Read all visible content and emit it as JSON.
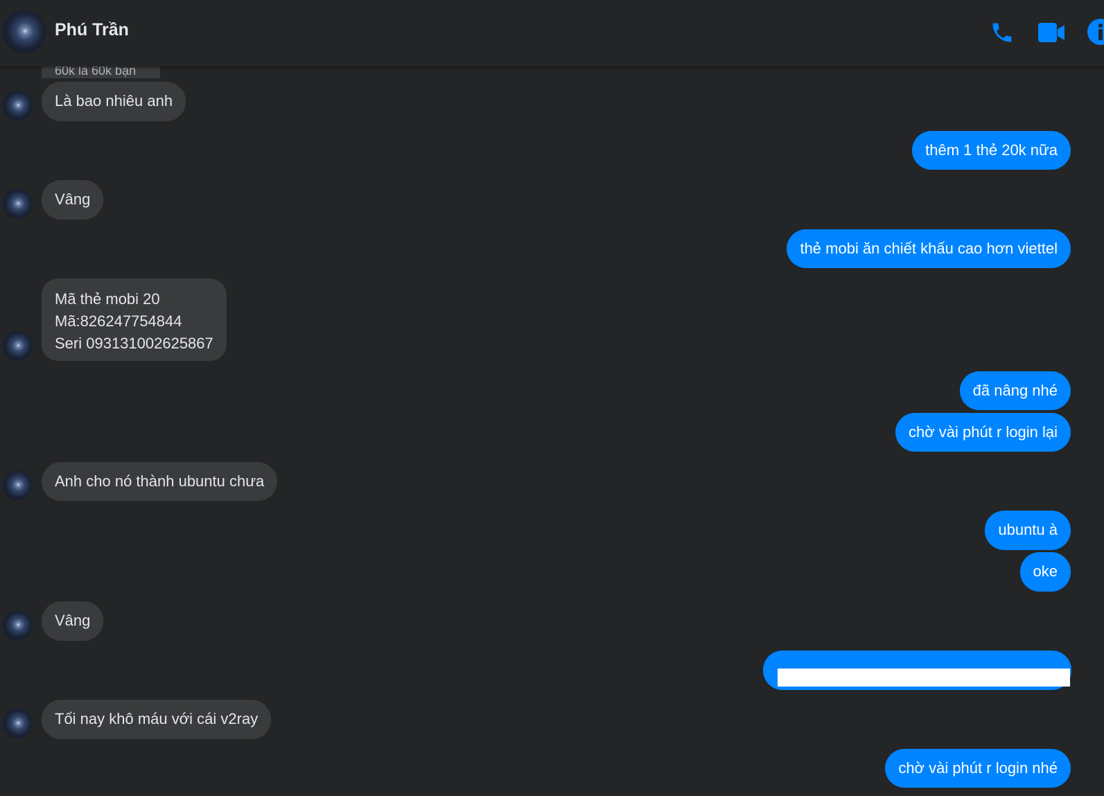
{
  "header": {
    "contact_name": "Phú Trần",
    "icons": [
      "phone-icon",
      "video-camera-icon",
      "info-icon"
    ],
    "accent_color": "#0084ff"
  },
  "messages": {
    "cut_off_text": "60k là 60k bạn",
    "m1": "Là bao nhiêu anh",
    "m2": "thêm 1 thẻ 20k nữa",
    "m3": "Vâng",
    "m4": "thẻ mobi ăn chiết khấu cao hơn viettel",
    "m5": "Mã thẻ mobi 20\nMã:826247754844\nSeri 093131002625867",
    "m6": "đã nâng nhé",
    "m7": "chờ vài phút r login lại",
    "m8": "Anh cho nó thành ubuntu chưa",
    "m9": "ubuntu à",
    "m10": "oke",
    "m11": "Vâng",
    "m13": "Tối nay khô máu với cái v2ray",
    "m14": "chờ vài phút r login nhé"
  },
  "colors": {
    "background": "#242526",
    "incoming_bubble": "#3a3b3c",
    "outgoing_bubble": "#0084ff"
  }
}
